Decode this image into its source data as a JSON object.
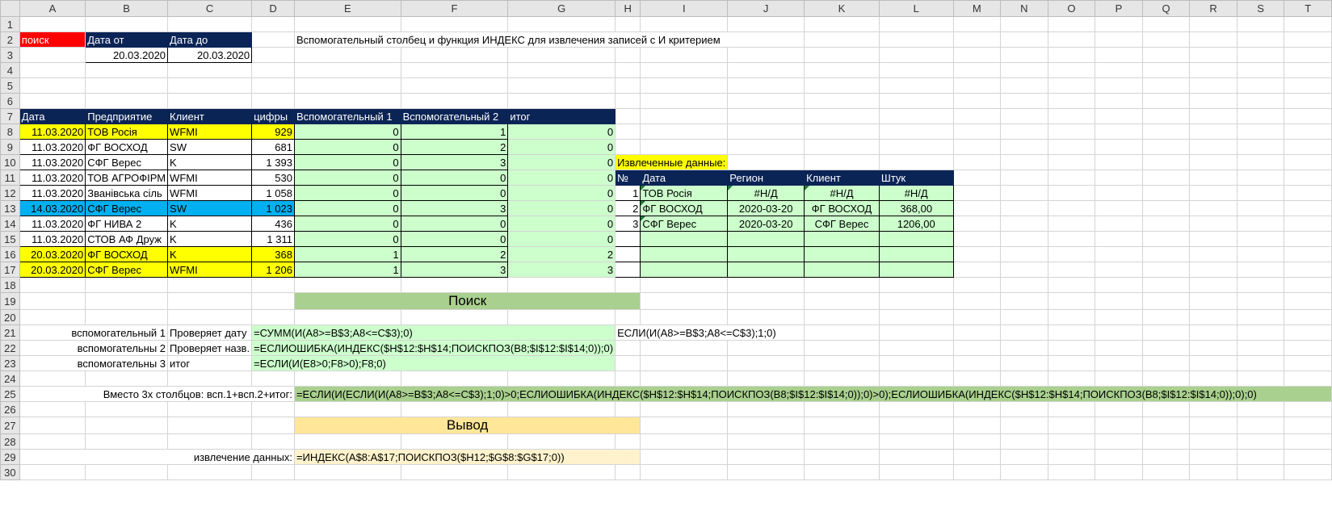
{
  "columns": [
    "A",
    "B",
    "C",
    "D",
    "E",
    "F",
    "G",
    "H",
    "I",
    "J",
    "K",
    "L",
    "M",
    "N",
    "O",
    "P",
    "Q",
    "R",
    "S",
    "T"
  ],
  "rows": [
    "1",
    "2",
    "3",
    "4",
    "5",
    "6",
    "7",
    "8",
    "9",
    "10",
    "11",
    "12",
    "13",
    "14",
    "15",
    "16",
    "17",
    "18",
    "19",
    "20",
    "21",
    "22",
    "23",
    "24",
    "25",
    "26",
    "27",
    "28",
    "29",
    "30"
  ],
  "search": {
    "label": "поиск",
    "date_from_label": "Дата от",
    "date_to_label": "Дата до",
    "date_from": "20.03.2020",
    "date_to": "20.03.2020"
  },
  "title": "Вспомогательный столбец и функция ИНДЕКС для извлечения записей с И критерием",
  "table_headers": [
    "Дата",
    "Предприятие",
    "Клиент",
    "цифры",
    "Вспомогательный 1",
    "Вспомогательный 2",
    "итог"
  ],
  "data_rows": [
    {
      "date": "11.03.2020",
      "company": "ТОВ Росія",
      "client": "WFMI",
      "num": "929",
      "aux1": "0",
      "aux2": "1",
      "total": "0"
    },
    {
      "date": "11.03.2020",
      "company": "ФГ ВОСХОД",
      "client": "SW",
      "num": "681",
      "aux1": "0",
      "aux2": "2",
      "total": "0"
    },
    {
      "date": "11.03.2020",
      "company": "СФГ Верес",
      "client": "K",
      "num": "1 393",
      "aux1": "0",
      "aux2": "3",
      "total": "0"
    },
    {
      "date": "11.03.2020",
      "company": "ТОВ АГРОФІРМ",
      "client": "WFMI",
      "num": "530",
      "aux1": "0",
      "aux2": "0",
      "total": "0"
    },
    {
      "date": "11.03.2020",
      "company": "Званівська сіль",
      "client": "WFMI",
      "num": "1 058",
      "aux1": "0",
      "aux2": "0",
      "total": "0"
    },
    {
      "date": "14.03.2020",
      "company": "СФГ Верес",
      "client": "SW",
      "num": "1 023",
      "aux1": "0",
      "aux2": "3",
      "total": "0"
    },
    {
      "date": "11.03.2020",
      "company": "ФГ НИВА 2",
      "client": "K",
      "num": "436",
      "aux1": "0",
      "aux2": "0",
      "total": "0"
    },
    {
      "date": "11.03.2020",
      "company": "СТОВ АФ Друж",
      "client": "K",
      "num": "1 311",
      "aux1": "0",
      "aux2": "0",
      "total": "0"
    },
    {
      "date": "20.03.2020",
      "company": "ФГ ВОСХОД",
      "client": "K",
      "num": "368",
      "aux1": "1",
      "aux2": "2",
      "total": "2"
    },
    {
      "date": "20.03.2020",
      "company": "СФГ Верес",
      "client": "WFMI",
      "num": "1 206",
      "aux1": "1",
      "aux2": "3",
      "total": "3"
    }
  ],
  "extracted": {
    "label": "Извлеченные данные:",
    "headers": [
      "№",
      "Дата",
      "Регион",
      "Клиент",
      "Штук"
    ],
    "rows": [
      {
        "n": "1",
        "name": "ТОВ Росія",
        "c1": "#Н/Д",
        "c2": "#Н/Д",
        "c3": "#Н/Д"
      },
      {
        "n": "2",
        "name": "ФГ ВОСХОД",
        "c1": "2020-03-20",
        "c2": "ФГ ВОСХОД",
        "c3": "368,00"
      },
      {
        "n": "3",
        "name": "СФГ Верес",
        "c1": "2020-03-20",
        "c2": "СФГ Верес",
        "c3": "1206,00"
      }
    ]
  },
  "search_section": {
    "title": "Поиск"
  },
  "aux_rows": [
    {
      "label": "вспомогательный 1",
      "desc": "Проверяет дату",
      "formula": "=СУММ(И(A8>=B$3;A8<=C$3);0)"
    },
    {
      "label": "вспомогательны 2",
      "desc": "Проверяет назв.",
      "formula": "=ЕСЛИОШИБКА(ИНДЕКС($H$12:$H$14;ПОИСКПОЗ(B8;$I$12:$I$14;0));0)"
    },
    {
      "label": "вспомогательны 3",
      "desc": "итог",
      "formula": "=ЕСЛИ(И(E8>0;F8>0);F8;0)"
    }
  ],
  "side_formula": "ЕСЛИ(И(A8>=B$3;A8<=C$3);1;0)",
  "combined": {
    "label": "Вместо 3х столбцов: всп.1+всп.2+итог:",
    "formula": "=ЕСЛИ(И(ЕСЛИ(И(A8>=B$3;A8<=C$3);1;0)>0;ЕСЛИОШИБКА(ИНДЕКС($H$12:$H$14;ПОИСКПОЗ(B8;$I$12:$I$14;0));0)>0);ЕСЛИОШИБКА(ИНДЕКС($H$12:$H$14;ПОИСКПОЗ(B8;$I$12:$I$14;0));0);0)"
  },
  "output_section": {
    "title": "Вывод"
  },
  "extraction": {
    "label": "извлечение данных:",
    "formula": "=ИНДЕКС(A$8:A$17;ПОИСКПОЗ($H12;$G$8:$G$17;0))"
  },
  "colors": {
    "navy": "#0b2456",
    "red": "#ff0000",
    "yellow": "#ffff00",
    "cyan": "#00b0f0",
    "light_green": "#ccffcc",
    "olive": "#a9d08e",
    "peach": "#ffe699"
  }
}
